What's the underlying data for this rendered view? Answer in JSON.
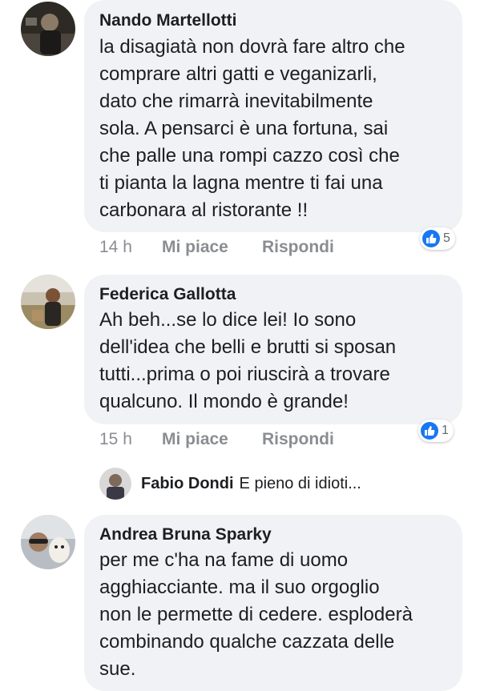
{
  "comments": [
    {
      "author": "Nando Martellotti",
      "text": "la disagiatà non dovrà fare altro che\ncomprare altri gatti e veganizarli,\ndato che rimarrà inevitabilmente\nsola. A pensarci è una fortuna, sai\nche palle una rompi cazzo così che\nti pianta la lagna mentre ti fai una\ncarbonara al ristorante !!",
      "time": "14 h",
      "like_label": "Mi piace",
      "reply_label": "Rispondi",
      "reaction_count": "5"
    },
    {
      "author": "Federica Gallotta",
      "text": "Ah beh...se lo dice lei! Io sono\ndell'idea che belli e brutti si sposan\ntutti...prima o poi riuscirà a trovare\nqualcuno. Il mondo è grande!",
      "time": "15 h",
      "like_label": "Mi piace",
      "reply_label": "Rispondi",
      "reaction_count": "1",
      "reply_preview": {
        "author": "Fabio Dondi",
        "text": "E pieno di idioti..."
      }
    },
    {
      "author": "Andrea Bruna Sparky",
      "text": "per me c'ha na fame di uomo\nagghiacciante. ma il suo orgoglio\nnon le permette di cedere. esploderà\ncombinando qualche cazzata delle\nsue."
    }
  ],
  "colors": {
    "bubble": "#f0f2f5",
    "meta": "#8a8d91",
    "like_blue": "#1877f2"
  },
  "icons": [
    "avatar",
    "like-icon"
  ]
}
